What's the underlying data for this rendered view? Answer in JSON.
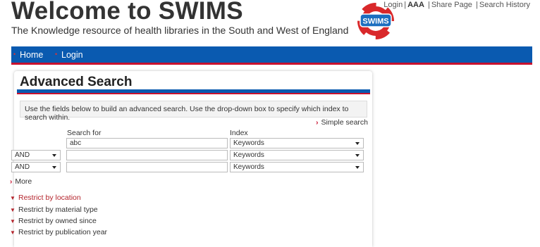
{
  "header": {
    "title": "Welcome to SWIMS",
    "subtitle": "The Knowledge resource of health libraries in the South and West of England",
    "logo_text": "SWIMS"
  },
  "utility": {
    "login": "Login",
    "text_size": "AAA",
    "share": "Share Page",
    "history": "Search History"
  },
  "nav": {
    "items": [
      "Home",
      "Login"
    ]
  },
  "panel": {
    "title": "Advanced Search",
    "instructions": "Use the fields below to build an advanced search. Use the drop-down box to specify which index to search within.",
    "simple_search": "Simple search",
    "search_for_label": "Search for",
    "index_label": "Index",
    "rows": [
      {
        "operator": "",
        "value": "abc",
        "index": "Keywords"
      },
      {
        "operator": "AND",
        "value": "",
        "index": "Keywords"
      },
      {
        "operator": "AND",
        "value": "",
        "index": "Keywords"
      }
    ],
    "more": "More",
    "restrictions": [
      "Restrict by location",
      "Restrict by material type",
      "Restrict by owned since",
      "Restrict by publication year"
    ]
  },
  "colors": {
    "nav_blue": "#0a5ab0",
    "accent_red": "#c8102e",
    "active_link": "#b4232b"
  }
}
